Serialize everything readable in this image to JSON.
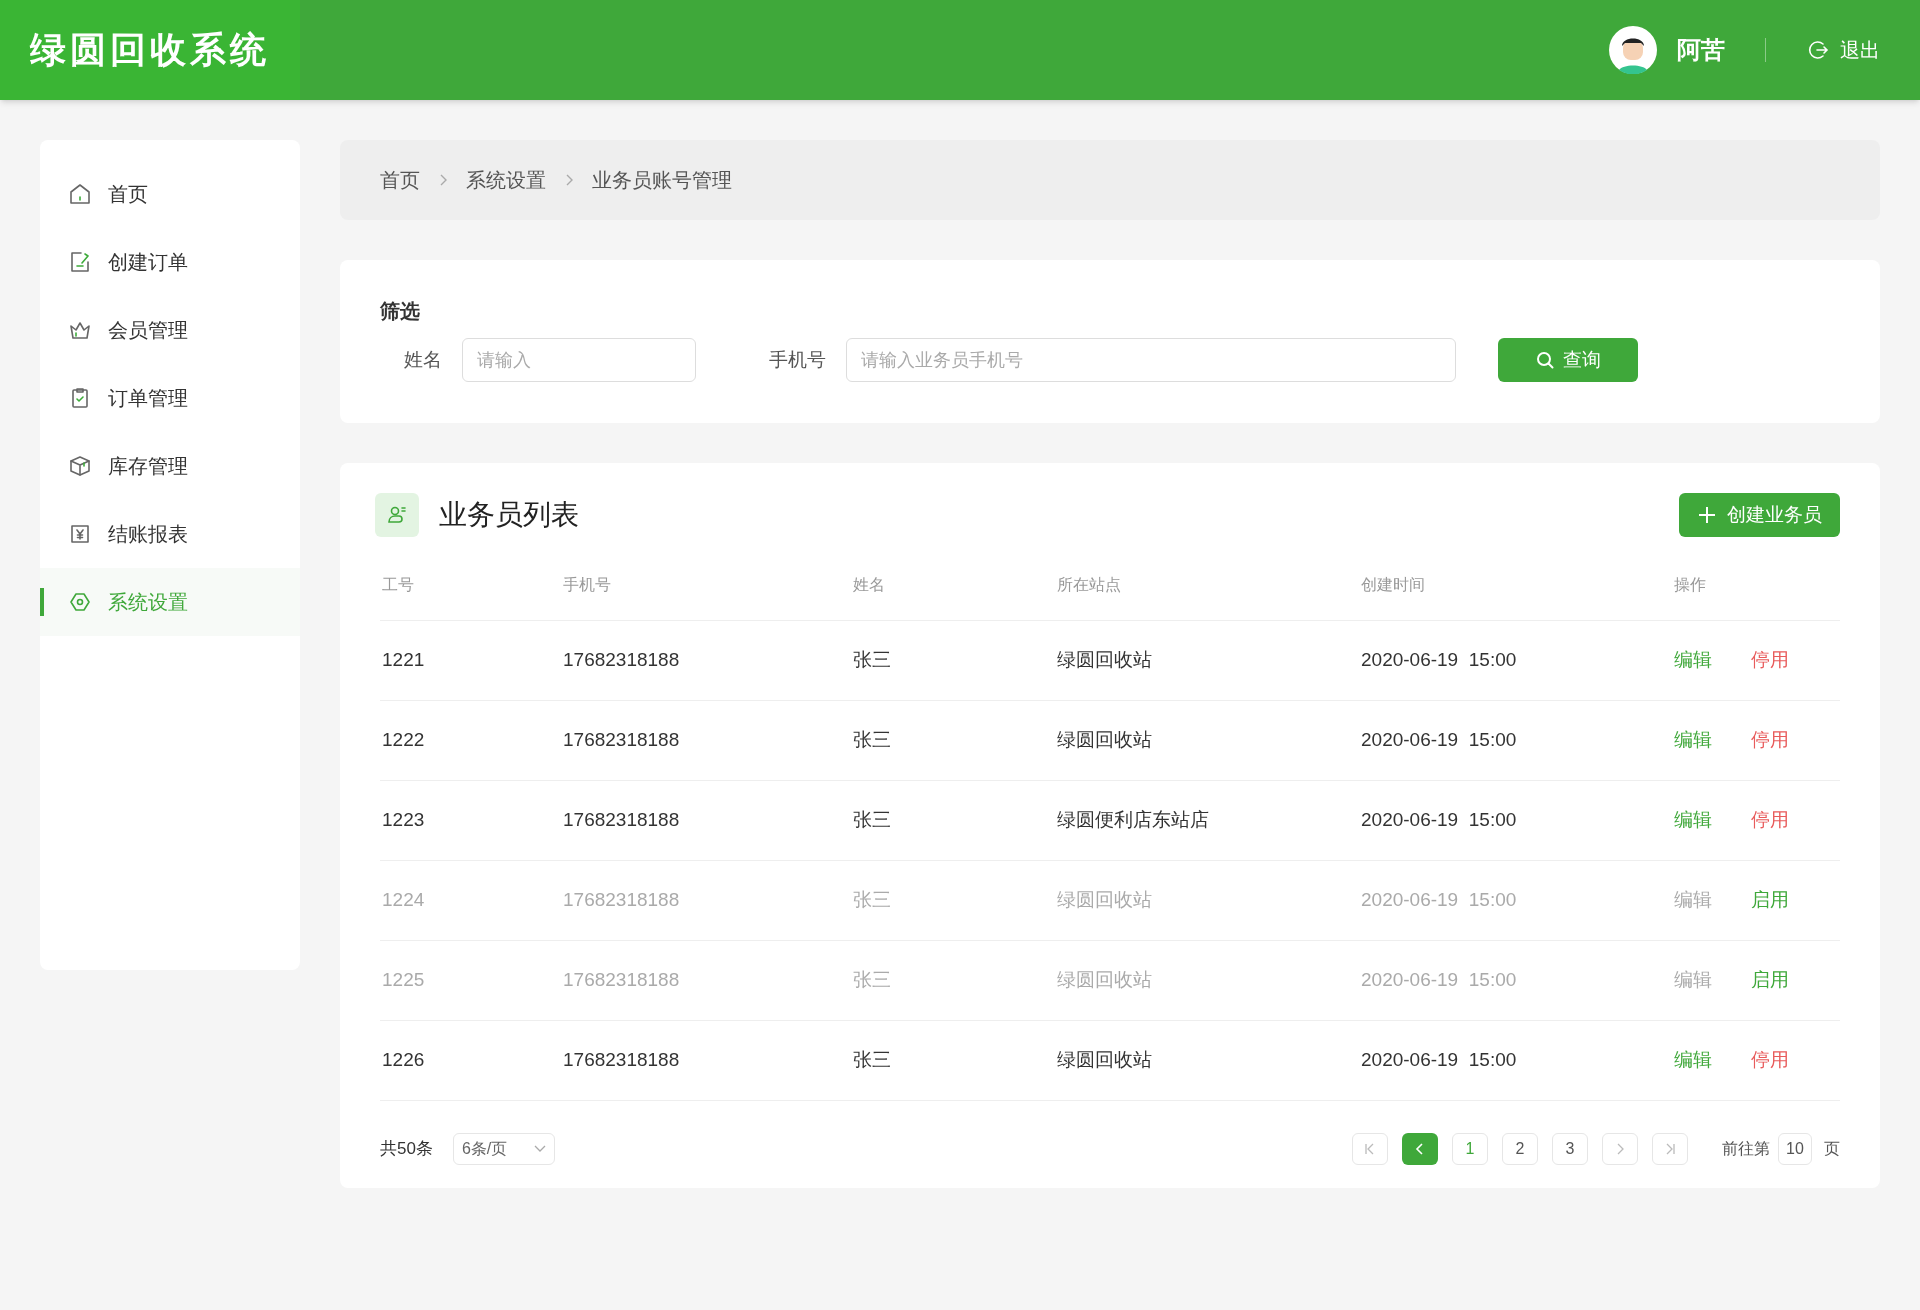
{
  "header": {
    "logo": "绿圆回收系统",
    "user": "阿苦",
    "logout": "退出"
  },
  "sidebar": {
    "items": [
      {
        "label": "首页",
        "selected": false
      },
      {
        "label": "创建订单",
        "selected": false
      },
      {
        "label": "会员管理",
        "selected": false
      },
      {
        "label": "订单管理",
        "selected": false
      },
      {
        "label": "库存管理",
        "selected": false
      },
      {
        "label": "结账报表",
        "selected": false
      },
      {
        "label": "系统设置",
        "selected": true
      }
    ]
  },
  "breadcrumb": [
    "首页",
    "系统设置",
    "业务员账号管理"
  ],
  "filter": {
    "title": "筛选",
    "fields": [
      {
        "label": "姓名",
        "placeholder": "请输入"
      },
      {
        "label": "手机号",
        "placeholder": "请输入业务员手机号"
      }
    ],
    "search_button": "查询"
  },
  "list": {
    "title": "业务员列表",
    "create_button": "创建业务员",
    "columns": [
      "工号",
      "手机号",
      "姓名",
      "所在站点",
      "创建时间",
      "操作"
    ],
    "rows": [
      {
        "id": "1221",
        "phone": "17682318188",
        "name": "张三",
        "station": "绿圆回收站",
        "created": "2020-06-19  15:00",
        "edit": "编辑",
        "toggle": "停用",
        "enabled": true
      },
      {
        "id": "1222",
        "phone": "17682318188",
        "name": "张三",
        "station": "绿圆回收站",
        "created": "2020-06-19  15:00",
        "edit": "编辑",
        "toggle": "停用",
        "enabled": true
      },
      {
        "id": "1223",
        "phone": "17682318188",
        "name": "张三",
        "station": "绿圆便利店东站店",
        "created": "2020-06-19  15:00",
        "edit": "编辑",
        "toggle": "停用",
        "enabled": true
      },
      {
        "id": "1224",
        "phone": "17682318188",
        "name": "张三",
        "station": "绿圆回收站",
        "created": "2020-06-19  15:00",
        "edit": "编辑",
        "toggle": "启用",
        "enabled": false
      },
      {
        "id": "1225",
        "phone": "17682318188",
        "name": "张三",
        "station": "绿圆回收站",
        "created": "2020-06-19  15:00",
        "edit": "编辑",
        "toggle": "启用",
        "enabled": false
      },
      {
        "id": "1226",
        "phone": "17682318188",
        "name": "张三",
        "station": "绿圆回收站",
        "created": "2020-06-19  15:00",
        "edit": "编辑",
        "toggle": "停用",
        "enabled": true
      }
    ]
  },
  "pagination": {
    "total": "共50条",
    "page_size": "6条/页",
    "pages": [
      {
        "label": "1",
        "selected": true
      },
      {
        "label": "2",
        "selected": false
      },
      {
        "label": "3",
        "selected": false
      }
    ],
    "goto_prefix": "前往第",
    "goto_value": "10",
    "goto_suffix": "页"
  }
}
